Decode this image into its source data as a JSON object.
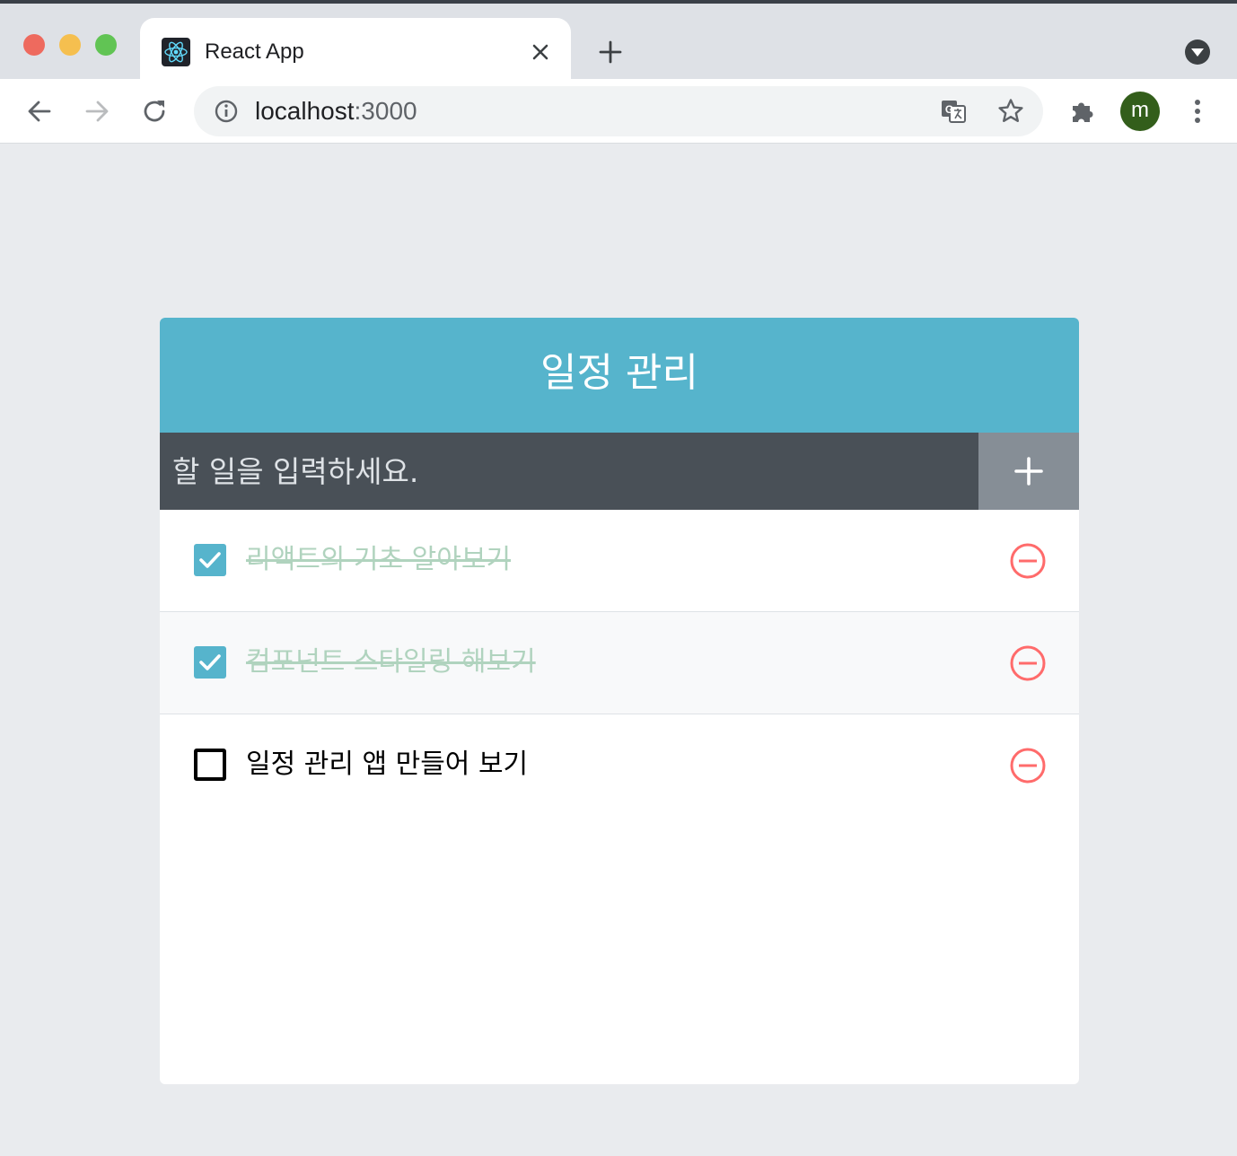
{
  "browser": {
    "tab_title": "React App",
    "url_host": "localhost",
    "url_port": ":3000",
    "profile_initial": "m"
  },
  "app": {
    "header_title": "일정 관리",
    "input_placeholder": "할 일을 입력하세요.",
    "input_value": "",
    "accent_color": "#56b4cc",
    "remove_color": "#ff6b6b",
    "todos": [
      {
        "text": "리액트의 기초 알아보기",
        "checked": true
      },
      {
        "text": "컴포넌트 스타일링 해보기",
        "checked": true
      },
      {
        "text": "일정 관리 앱 만들어 보기",
        "checked": false
      }
    ]
  }
}
